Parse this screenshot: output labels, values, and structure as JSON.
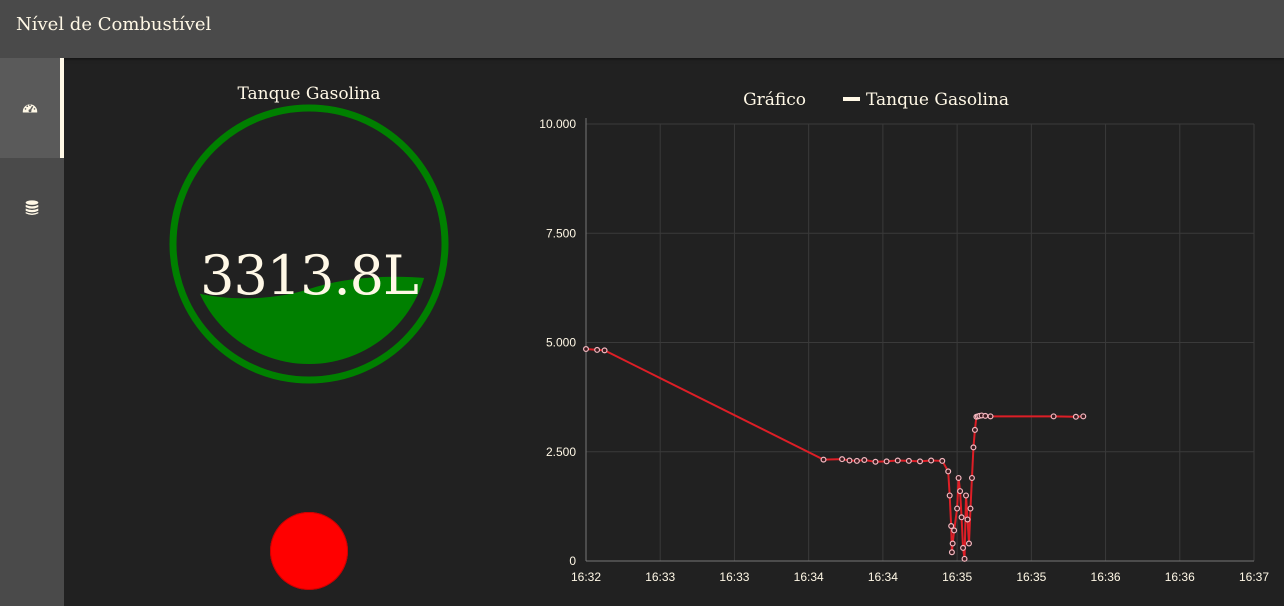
{
  "header": {
    "title": "Nível de Combustível"
  },
  "sidebar": {
    "items": [
      {
        "icon": "dashboard-gauge-icon",
        "active": true
      },
      {
        "icon": "database-icon",
        "active": false
      }
    ]
  },
  "gauge": {
    "title": "Tanque Gasolina",
    "value": "3313.8L",
    "color": "#008000",
    "fill_level": 0.33
  },
  "led": {
    "color": "#ff0000"
  },
  "chart_title": "Gráfico",
  "chart_data": {
    "type": "line",
    "title": "Gráfico",
    "legend": "Tanque Gasolina",
    "legend_position": "top",
    "grid": true,
    "ylim": [
      0,
      10000
    ],
    "y_ticks": [
      "10.000",
      "7.500",
      "5.000",
      "2.500",
      "0"
    ],
    "y_tick_values": [
      10000,
      7500,
      5000,
      2500,
      0
    ],
    "x_ticks": [
      "16:32",
      "16:33",
      "16:33",
      "16:34",
      "16:34",
      "16:35",
      "16:35",
      "16:36",
      "16:36",
      "16:37"
    ],
    "series_color": "#dd1e26",
    "marker_color": "#f4b8c0",
    "series": [
      {
        "name": "Tanque Gasolina",
        "x": [
          0.0,
          0.15,
          0.25,
          3.2,
          3.45,
          3.55,
          3.65,
          3.75,
          3.9,
          4.05,
          4.2,
          4.35,
          4.5,
          4.65,
          4.8,
          4.88,
          4.9,
          4.92,
          4.93,
          4.94,
          4.96,
          5.0,
          5.02,
          5.04,
          5.06,
          5.08,
          5.1,
          5.12,
          5.14,
          5.16,
          5.18,
          5.2,
          5.22,
          5.24,
          5.26,
          5.28,
          5.3,
          5.33,
          5.38,
          5.45,
          6.3,
          6.6,
          6.7
        ],
        "values": [
          4850,
          4830,
          4820,
          2320,
          2330,
          2300,
          2290,
          2310,
          2270,
          2280,
          2300,
          2290,
          2280,
          2300,
          2290,
          2050,
          1500,
          800,
          200,
          400,
          700,
          1200,
          1900,
          1600,
          1000,
          300,
          50,
          1500,
          950,
          400,
          1200,
          1900,
          2600,
          3000,
          3300,
          3310,
          3320,
          3330,
          3320,
          3310,
          3310,
          3300,
          3310
        ]
      }
    ]
  }
}
